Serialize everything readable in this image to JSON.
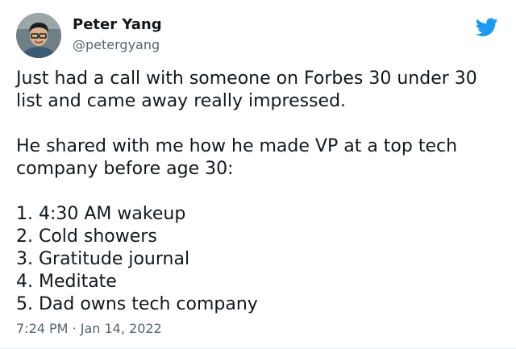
{
  "tweet": {
    "author": {
      "display_name": "Peter Yang",
      "handle": "@petergyang"
    },
    "paragraphs": [
      "Just had a call with someone on Forbes 30 under 30 list and came away really impressed.",
      "He shared with me how he made VP at a top tech company before age 30:"
    ],
    "list_items": [
      "1. 4:30 AM wakeup",
      "2. Cold showers",
      "3. Gratitude journal",
      "4. Meditate",
      "5. Dad owns tech company"
    ],
    "timestamp": "7:24 PM · Jan 14, 2022"
  },
  "icons": {
    "brand": "twitter-bird-icon",
    "brand_color": "#1d9bf0"
  }
}
